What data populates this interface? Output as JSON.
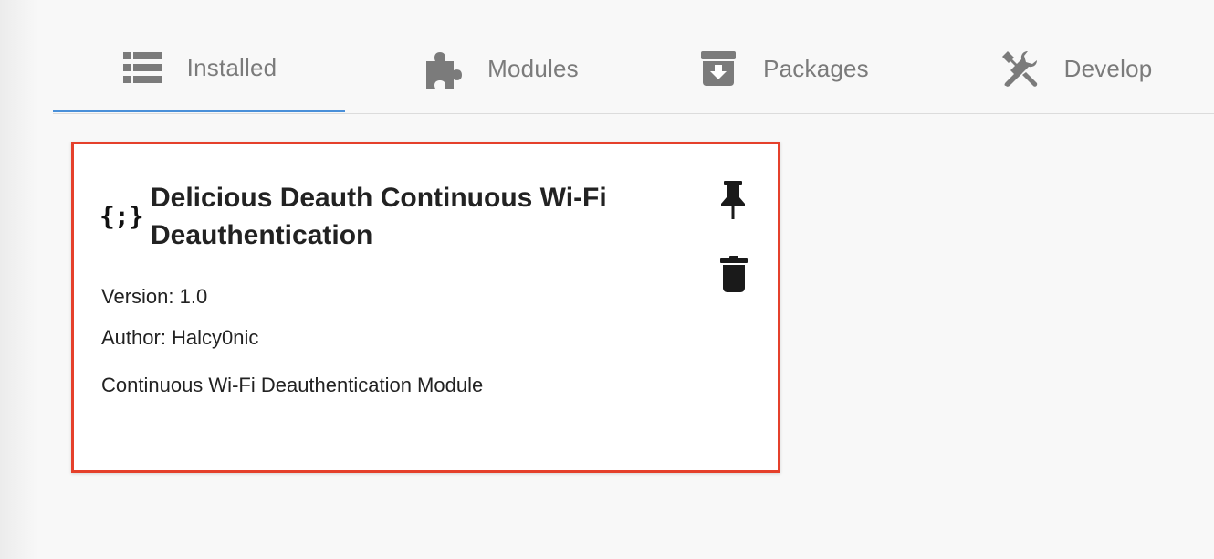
{
  "tabs": [
    {
      "label": "Installed",
      "icon": "list-icon",
      "active": true
    },
    {
      "label": "Modules",
      "icon": "puzzle-icon",
      "active": false
    },
    {
      "label": "Packages",
      "icon": "archive-download-icon",
      "active": false
    },
    {
      "label": "Develop",
      "icon": "tools-icon",
      "active": false
    }
  ],
  "colors": {
    "active_tab_underline": "#4a90d9",
    "highlight_border": "#e5402b",
    "tab_text": "#7b7b7b"
  },
  "module_card": {
    "logo_text": "{;}",
    "title": "Delicious Deauth Continuous Wi-Fi Deauthentication",
    "version": "Version: 1.0",
    "author": "Author: Halcy0nic",
    "description": "Continuous Wi-Fi Deauthentication Module",
    "actions": [
      "pin-icon",
      "trash-icon"
    ]
  }
}
